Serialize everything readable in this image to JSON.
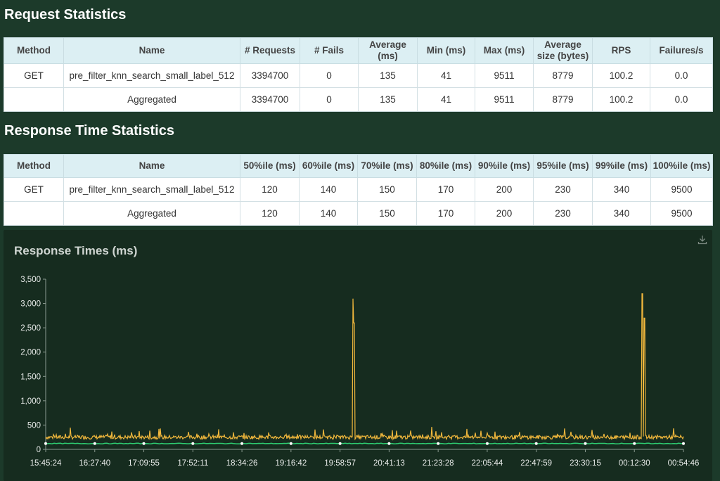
{
  "request_statistics": {
    "title": "Request Statistics",
    "headers": [
      "Method",
      "Name",
      "# Requests",
      "# Fails",
      "Average (ms)",
      "Min (ms)",
      "Max (ms)",
      "Average size (bytes)",
      "RPS",
      "Failures/s"
    ],
    "rows": [
      [
        "GET",
        "pre_filter_knn_search_small_label_512",
        "3394700",
        "0",
        "135",
        "41",
        "9511",
        "8779",
        "100.2",
        "0.0"
      ],
      [
        "",
        "Aggregated",
        "3394700",
        "0",
        "135",
        "41",
        "9511",
        "8779",
        "100.2",
        "0.0"
      ]
    ]
  },
  "response_time_statistics": {
    "title": "Response Time Statistics",
    "headers": [
      "Method",
      "Name",
      "50%ile (ms)",
      "60%ile (ms)",
      "70%ile (ms)",
      "80%ile (ms)",
      "90%ile (ms)",
      "95%ile (ms)",
      "99%ile (ms)",
      "100%ile (ms)"
    ],
    "rows": [
      [
        "GET",
        "pre_filter_knn_search_small_label_512",
        "120",
        "140",
        "150",
        "170",
        "200",
        "230",
        "340",
        "9500"
      ],
      [
        "",
        "Aggregated",
        "120",
        "140",
        "150",
        "170",
        "200",
        "230",
        "340",
        "9500"
      ]
    ]
  },
  "response_times_chart": {
    "title": "Response Times (ms)",
    "download_icon": "download-icon"
  },
  "chart_data": {
    "type": "line",
    "title": "Response Times (ms)",
    "xlabel": "",
    "ylabel": "",
    "ylim": [
      0,
      3500
    ],
    "y_ticks": [
      "0",
      "500",
      "1,000",
      "1,500",
      "2,000",
      "2,500",
      "3,000",
      "3,500"
    ],
    "x_ticks": [
      "15:45:24",
      "16:27:40",
      "17:09:55",
      "17:52:11",
      "18:34:26",
      "19:16:42",
      "19:58:57",
      "20:41:13",
      "21:23:28",
      "22:05:44",
      "22:47:59",
      "23:30:15",
      "00:12:30",
      "00:54:46"
    ],
    "grid": false,
    "series": [
      {
        "color": "#f0b73c",
        "baseline": 250,
        "spikes": [
          {
            "x": "20:10:00",
            "y": 3100
          },
          {
            "x": "20:11:00",
            "y": 2600
          },
          {
            "x": "00:19:30",
            "y": 3200
          },
          {
            "x": "00:21:00",
            "y": 2700
          }
        ]
      },
      {
        "color": "#2ecc71",
        "baseline": 120
      }
    ]
  }
}
